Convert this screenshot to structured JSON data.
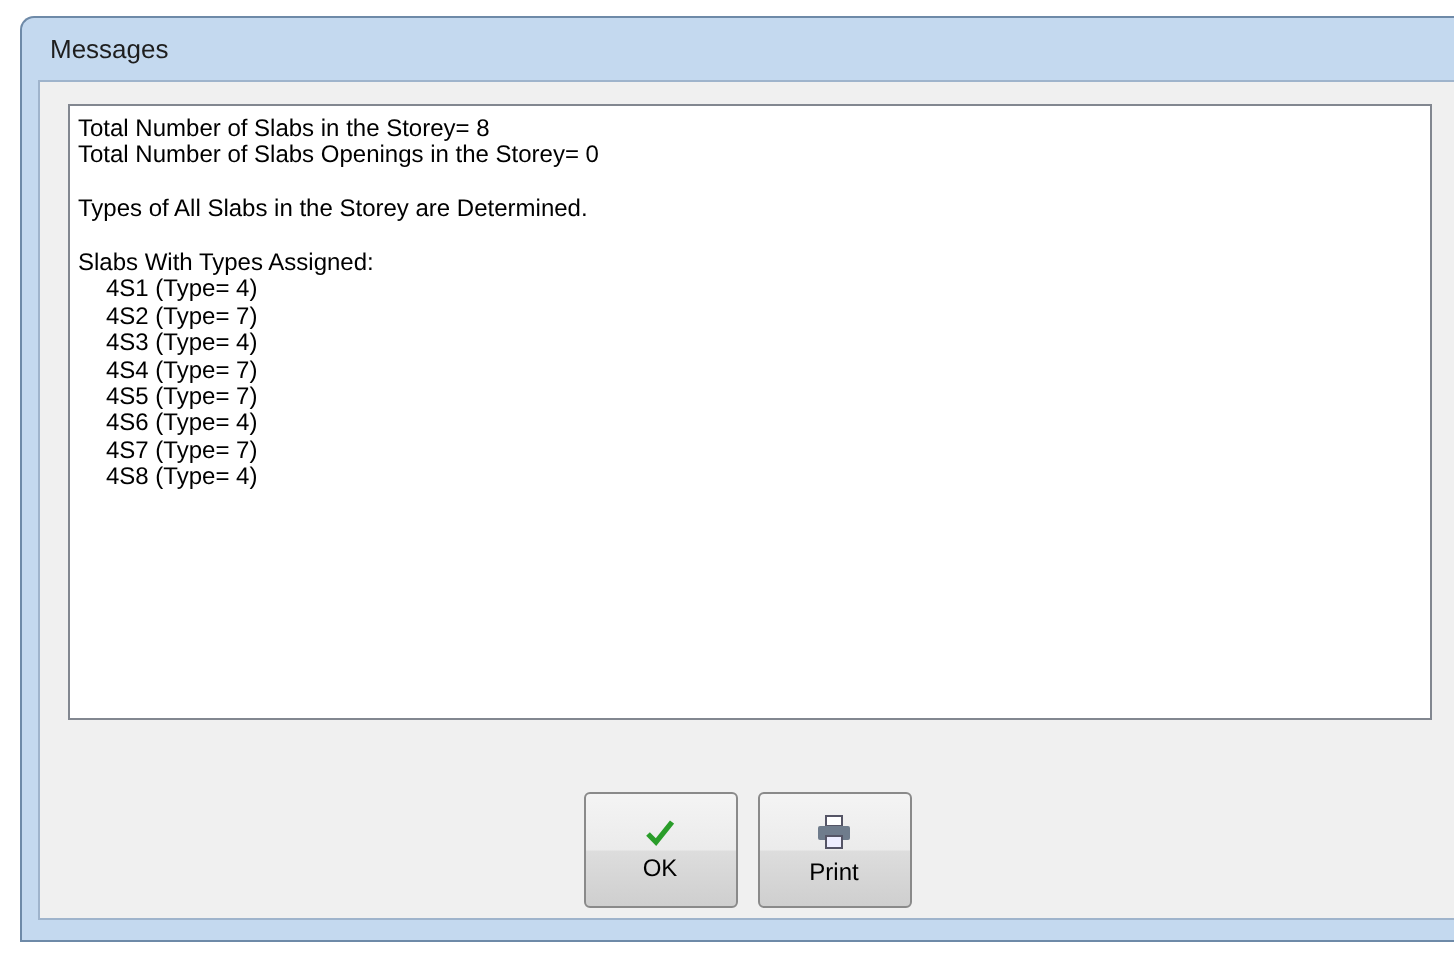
{
  "window": {
    "title": "Messages"
  },
  "message": {
    "paragraphs": [
      {
        "lines": [
          "Total Number of Slabs in the Storey= 8",
          "Total Number of Slabs Openings in the Storey= 0"
        ]
      },
      {
        "lines": [
          "Types of All Slabs in the Storey are Determined."
        ]
      },
      {
        "lines": [
          "Slabs With Types Assigned:"
        ],
        "children": [
          "4S1 (Type= 4)",
          "4S2 (Type= 7)",
          "4S3 (Type= 4)",
          "4S4 (Type= 7)",
          "4S5 (Type= 7)",
          "4S6 (Type= 4)",
          "4S7 (Type= 7)",
          "4S8 (Type= 4)"
        ]
      }
    ]
  },
  "buttons": [
    {
      "label": "OK",
      "kind": "ok"
    },
    {
      "label": "Print",
      "kind": "print"
    }
  ]
}
